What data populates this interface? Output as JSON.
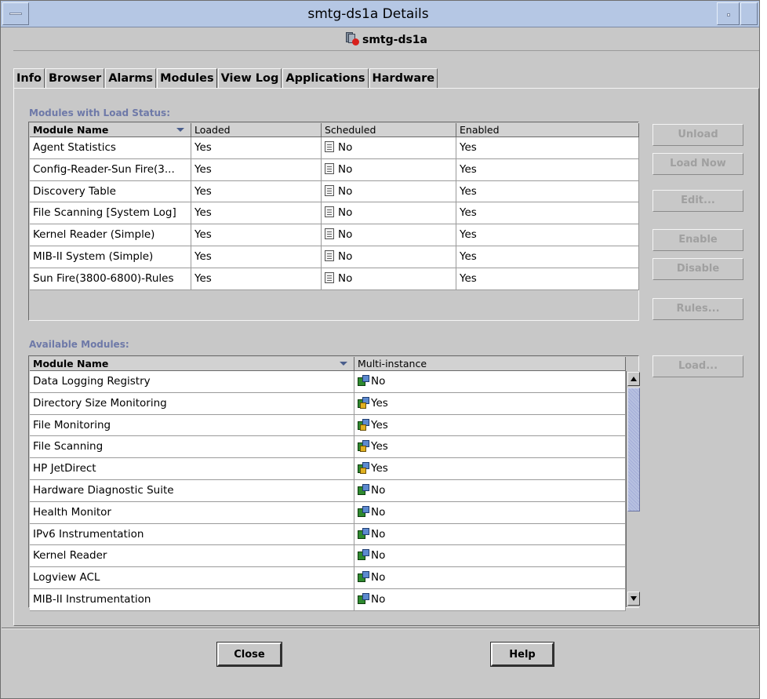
{
  "window": {
    "title": "smtg-ds1a Details"
  },
  "host": {
    "name": "smtg-ds1a",
    "icon": "server-alarm-icon"
  },
  "tabs": [
    "Info",
    "Browser",
    "Alarms",
    "Modules",
    "View Log",
    "Applications",
    "Hardware"
  ],
  "active_tab": "Modules",
  "loaded_modules": {
    "label": "Modules with Load Status:",
    "columns": [
      "Module Name",
      "Loaded",
      "Scheduled",
      "Enabled"
    ],
    "sorted_by": "Module Name",
    "rows": [
      {
        "name": "Agent Statistics",
        "loaded": "Yes",
        "scheduled": "No",
        "enabled": "Yes"
      },
      {
        "name": "Config-Reader-Sun Fire(3...",
        "loaded": "Yes",
        "scheduled": "No",
        "enabled": "Yes"
      },
      {
        "name": "Discovery Table",
        "loaded": "Yes",
        "scheduled": "No",
        "enabled": "Yes"
      },
      {
        "name": "File Scanning [System Log]",
        "loaded": "Yes",
        "scheduled": "No",
        "enabled": "Yes"
      },
      {
        "name": "Kernel Reader (Simple)",
        "loaded": "Yes",
        "scheduled": "No",
        "enabled": "Yes"
      },
      {
        "name": "MIB-II System (Simple)",
        "loaded": "Yes",
        "scheduled": "No",
        "enabled": "Yes"
      },
      {
        "name": "Sun Fire(3800-6800)-Rules",
        "loaded": "Yes",
        "scheduled": "No",
        "enabled": "Yes"
      }
    ],
    "scheduled_icon": "document-icon"
  },
  "loaded_buttons": [
    "Unload",
    "Load Now",
    "Edit...",
    "Enable",
    "Disable",
    "Rules..."
  ],
  "available_modules": {
    "label": "Available Modules:",
    "columns": [
      "Module Name",
      "Multi-instance"
    ],
    "sorted_by": "Module Name",
    "rows": [
      {
        "name": "Data Logging Registry",
        "multi": "No"
      },
      {
        "name": "Directory Size Monitoring",
        "multi": "Yes"
      },
      {
        "name": "File Monitoring",
        "multi": "Yes"
      },
      {
        "name": "File Scanning",
        "multi": "Yes"
      },
      {
        "name": "HP JetDirect",
        "multi": "Yes"
      },
      {
        "name": "Hardware Diagnostic Suite",
        "multi": "No"
      },
      {
        "name": "Health Monitor",
        "multi": "No"
      },
      {
        "name": "IPv6 Instrumentation",
        "multi": "No"
      },
      {
        "name": "Kernel Reader",
        "multi": "No"
      },
      {
        "name": "Logview ACL",
        "multi": "No"
      },
      {
        "name": "MIB-II Instrumentation",
        "multi": "No"
      }
    ]
  },
  "available_buttons": [
    "Load..."
  ],
  "footer": {
    "close_label": "Close",
    "help_label": "Help"
  },
  "colors": {
    "titlebar": "#b5c7e4",
    "panel": "#c8c8c8",
    "section_label": "#6e79a8",
    "disabled_text": "#a0a0a0"
  }
}
